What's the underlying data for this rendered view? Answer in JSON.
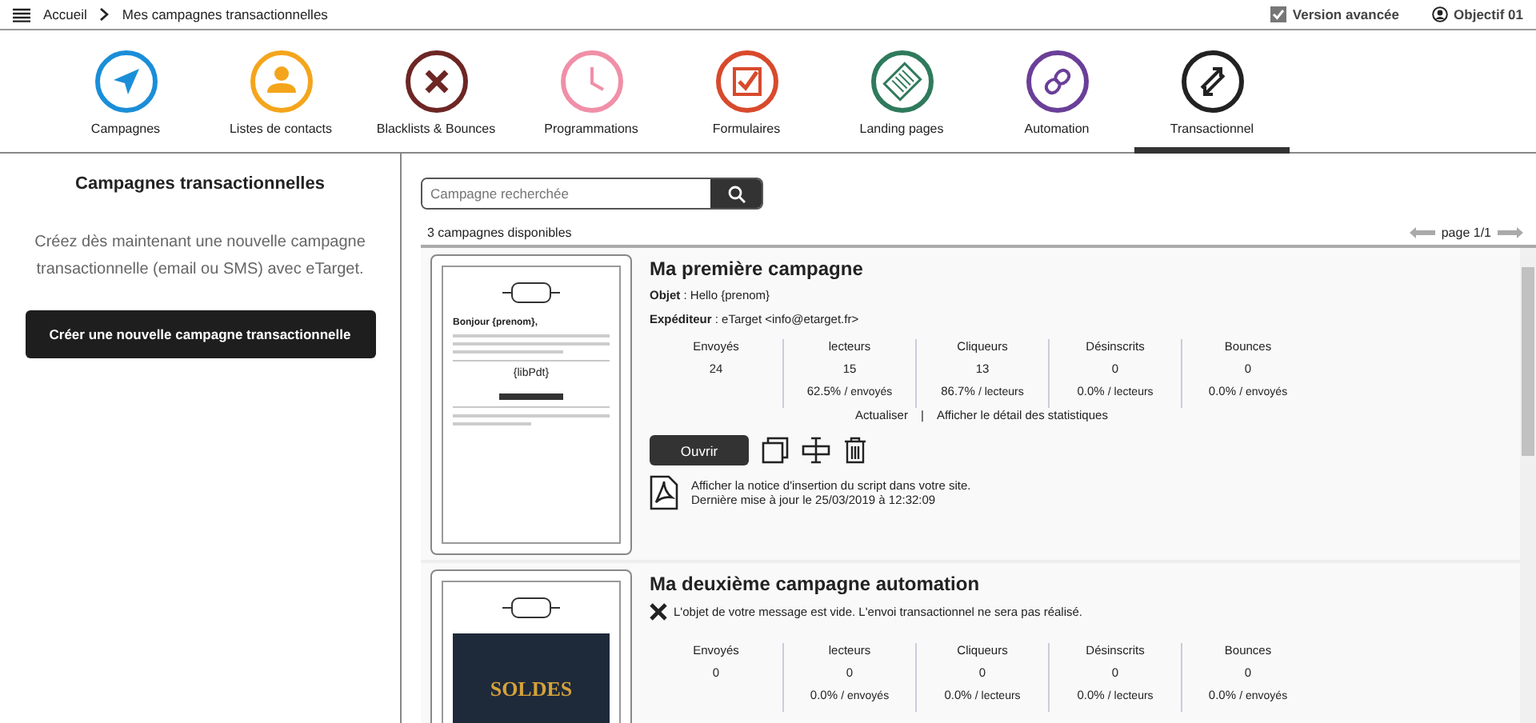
{
  "topbar": {
    "breadcrumb": [
      "Accueil",
      "Mes campagnes transactionnelles"
    ],
    "advanced": {
      "label": "Version avancée",
      "checked": true
    },
    "user": "Objectif 01"
  },
  "nav": [
    {
      "label": "Campagnes",
      "kind": "send",
      "color": "#1b8ed8",
      "selected": false
    },
    {
      "label": "Listes de contacts",
      "kind": "contacts",
      "color": "#f4a51c",
      "selected": false
    },
    {
      "label": "Blacklists & Bounces",
      "kind": "blacklist",
      "color": "#6d2624",
      "selected": false
    },
    {
      "label": "Programmations",
      "kind": "clock",
      "color": "#f08fa8",
      "selected": false
    },
    {
      "label": "Formulaires",
      "kind": "form",
      "color": "#d84a2c",
      "selected": false
    },
    {
      "label": "Landing pages",
      "kind": "landing",
      "color": "#2f7a5c",
      "selected": false
    },
    {
      "label": "Automation",
      "kind": "automation",
      "color": "#6a3f98",
      "selected": false
    },
    {
      "label": "Transactionnel",
      "kind": "transactional",
      "color": "#222222",
      "selected": true
    }
  ],
  "sidebar": {
    "title": "Campagnes transactionnelles",
    "description": "Créez dès maintenant une nouvelle campagne transactionnelle (email ou SMS) avec eTarget.",
    "button": "Créer une nouvelle campagne transactionnelle"
  },
  "search": {
    "placeholder": "Campagne recherchée"
  },
  "count": "3 campagnes disponibles",
  "pager": "page 1/1",
  "campaigns": [
    {
      "title": "Ma première campagne",
      "thumbnail": {
        "kind": "greeting",
        "texts": [
          "Bonjour {prenom},",
          "{libPdt}"
        ]
      },
      "subject": "**Objet** : Hello {prenom}",
      "sender": "**Expéditeur** : eTarget <info@etarget.fr>",
      "stats": [
        {
          "label": "Envoyés",
          "value": "24"
        },
        {
          "label": "lecteurs",
          "value": "15",
          "ratio": "62.5%",
          "unit": "/ envoyés"
        },
        {
          "label": "Cliqueurs",
          "value": "13",
          "ratio": "86.7%",
          "unit": "/ lecteurs"
        },
        {
          "label": "Désinscrits",
          "value": "0",
          "ratio": "0.0%",
          "unit": "/ lecteurs"
        },
        {
          "label": "Bounces",
          "value": "0",
          "ratio": "0.0%",
          "unit": "/ envoyés"
        }
      ],
      "links": [
        "Actualiser",
        "Afficher le détail des statistiques"
      ],
      "links_separator": "|",
      "open_button": "Ouvrir",
      "notice": "Afficher la notice d'insertion du script dans votre site.",
      "updated": "Dernière mise à jour le 25/03/2019 à 12:32:09"
    },
    {
      "title": "Ma deuxième campagne automation",
      "thumbnail": {
        "kind": "sale",
        "texts": [
          "SOLDES"
        ]
      },
      "warning": "L'objet de votre message est vide. L'envoi transactionnel ne sera pas réalisé.",
      "stats": [
        {
          "label": "Envoyés",
          "value": "0"
        },
        {
          "label": "lecteurs",
          "value": "0",
          "ratio": "0.0%",
          "unit": "/ envoyés"
        },
        {
          "label": "Cliqueurs",
          "value": "0",
          "ratio": "0.0%",
          "unit": "/ lecteurs"
        },
        {
          "label": "Désinscrits",
          "value": "0",
          "ratio": "0.0%",
          "unit": "/ lecteurs"
        },
        {
          "label": "Bounces",
          "value": "0",
          "ratio": "0.0%",
          "unit": "/ envoyés"
        }
      ]
    }
  ]
}
